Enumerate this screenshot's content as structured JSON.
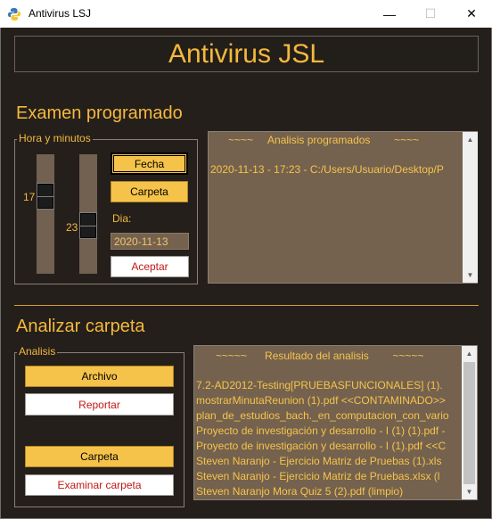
{
  "window": {
    "title": "Antivirus LSJ",
    "minimize": "—",
    "maximize": "☐",
    "close": "✕"
  },
  "header": {
    "title": "Antivirus JSL"
  },
  "scheduled": {
    "section_title": "Examen programado",
    "group_label": "Hora y minutos",
    "hours_value": "17",
    "minutes_value": "23",
    "fecha_button": "Fecha",
    "carpeta_button": "Carpeta",
    "dia_label": "Dia:",
    "date_value": "2020-11-13",
    "aceptar_button": "Aceptar",
    "list_header": "~~~~     Analisis programados        ~~~~",
    "list_items": [
      "2020-11-13 - 17:23 - C:/Users/Usuario/Desktop/P"
    ]
  },
  "analyze": {
    "section_title": "Analizar carpeta",
    "group_label": "Analisis",
    "archivo_button": "Archivo",
    "reportar_button": "Reportar",
    "carpeta_button": "Carpeta",
    "examinar_button": "Examinar carpeta",
    "list_header": "~~~~~      Resultado del analisis        ~~~~~",
    "list_items": [
      "7.2-AD2012-Testing[PRUEBASFUNCIONALES] (1).",
      "mostrarMinutaReunion (1).pdf <<CONTAMINADO>>",
      "plan_de_estudios_bach._en_computacion_con_vario",
      "Proyecto de investigación y desarrollo - I (1) (1).pdf -",
      "Proyecto de investigación y desarrollo - I (1).pdf <<C",
      "Steven Naranjo - Ejercicio Matriz de Pruebas (1).xls",
      "Steven Naranjo - Ejercicio Matriz de Pruebas.xlsx (l",
      "Steven Naranjo Mora Quiz 5 (2).pdf (limpio)"
    ]
  },
  "colors": {
    "background": "#241f1b",
    "accent_gold": "#f5b83d",
    "list_bg": "#74624f",
    "white_button_text": "#c31717"
  },
  "icons": {
    "app": "python-icon",
    "scroll_up": "triangle-up-icon",
    "scroll_down": "triangle-down-icon"
  }
}
